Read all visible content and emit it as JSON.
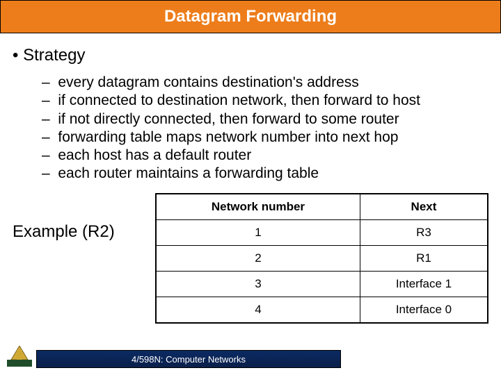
{
  "title": "Datagram Forwarding",
  "main_bullet": "Strategy",
  "sub_bullets": [
    "every datagram contains destination's address",
    "if connected to destination network, then forward to host",
    "if not directly connected, then forward to some router",
    "forwarding table maps network number into next hop",
    "each host has a default router",
    "each router maintains a forwarding table"
  ],
  "example_label": "Example (R2)",
  "table": {
    "headers": [
      "Network number",
      "Next"
    ],
    "rows": [
      [
        "1",
        "R3"
      ],
      [
        "2",
        "R1"
      ],
      [
        "3",
        "Interface 1"
      ],
      [
        "4",
        "Interface 0"
      ]
    ]
  },
  "footer_text": "4/598N: Computer Networks",
  "chart_data": {
    "type": "table",
    "title": "Example (R2)",
    "columns": [
      "Network number",
      "Next"
    ],
    "rows": [
      {
        "Network number": 1,
        "Next": "R3"
      },
      {
        "Network number": 2,
        "Next": "R1"
      },
      {
        "Network number": 3,
        "Next": "Interface 1"
      },
      {
        "Network number": 4,
        "Next": "Interface 0"
      }
    ]
  }
}
